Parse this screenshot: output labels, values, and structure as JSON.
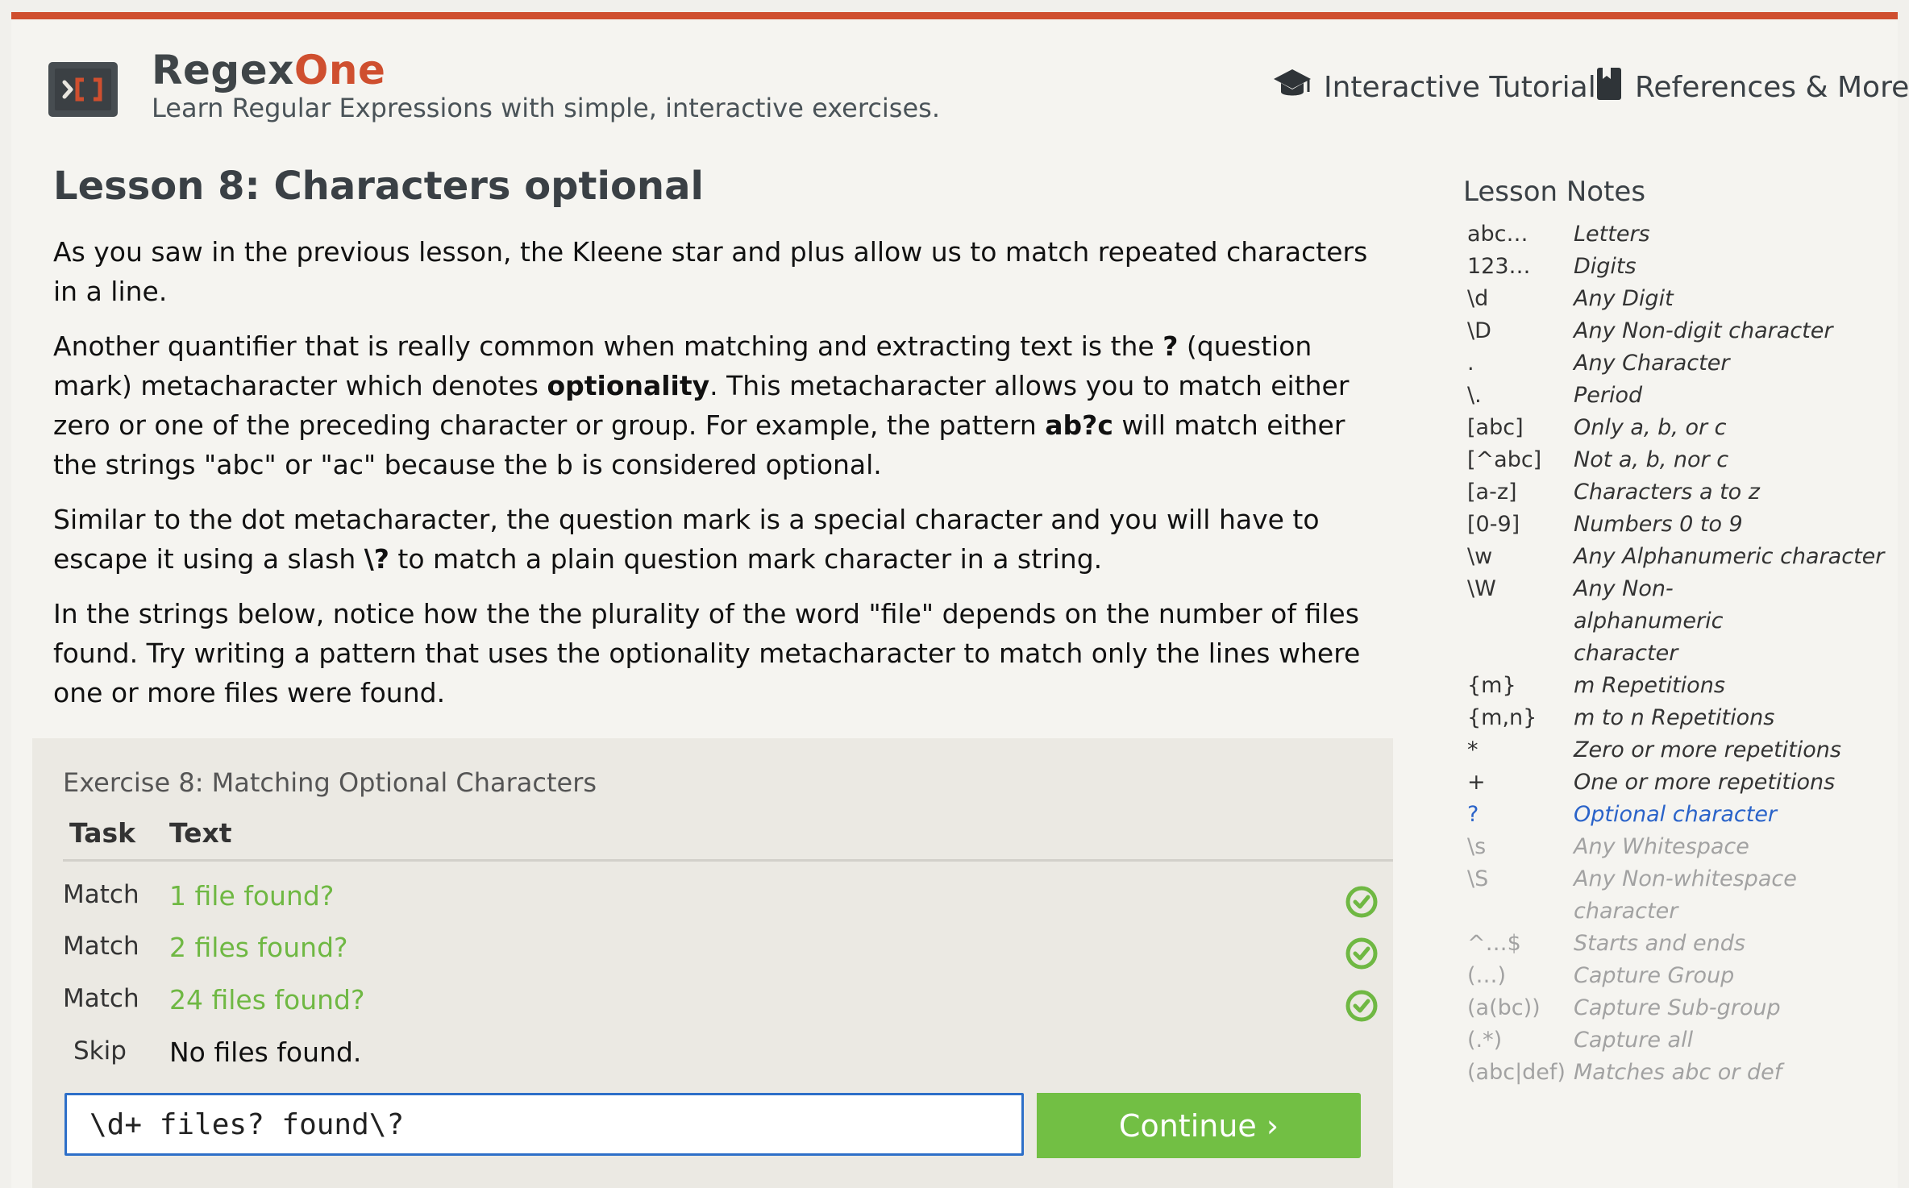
{
  "header": {
    "brand_main": "Regex",
    "brand_accent": "One",
    "tagline": "Learn Regular Expressions with simple, interactive exercises.",
    "logo_icon": "regex-bracket-logo-icon",
    "nav": {
      "tutorial": {
        "label": "Interactive Tutorial",
        "icon": "graduation-cap-icon"
      },
      "references": {
        "label": "References & More",
        "icon": "book-icon"
      }
    }
  },
  "colors": {
    "accent": "#cf4f2f",
    "success": "#6fb843",
    "continue": "#72bf44",
    "link": "#2a63c9",
    "input_border": "#2d6fc8"
  },
  "lesson": {
    "title": "Lesson 8: Characters optional",
    "p1": "As you saw in the previous lesson, the Kleene star and plus allow us to match repeated characters in a line.",
    "p2_a": "Another quantifier that is really common when matching and extracting text is the ",
    "p2_b": "?",
    "p2_c": " (question mark) metacharacter which denotes ",
    "p2_d": "optionality",
    "p2_e": ". This metacharacter allows you to match either zero or one of the preceding character or group. For example, the pattern ",
    "p2_f": "ab?c",
    "p2_g": " will match either the strings \"abc\" or \"ac\" because the b is considered optional.",
    "p3_a": "Similar to the dot metacharacter, the question mark is a special character and you will have to escape it using a slash ",
    "p3_b": "\\?",
    "p3_c": " to match a plain question mark character in a string.",
    "p4": "In the strings below, notice how the the plurality of the word \"file\" depends on the number of files found. Try writing a pattern that uses the optionality metacharacter to match only the lines where one or more files were found."
  },
  "exercise": {
    "title": "Exercise 8: Matching Optional Characters",
    "headers": {
      "task": "Task",
      "text": "Text"
    },
    "rows": [
      {
        "task": "Match",
        "text": "1 file found?",
        "status": "matched"
      },
      {
        "task": "Match",
        "text": "2 files found?",
        "status": "matched"
      },
      {
        "task": "Match",
        "text": "24 files found?",
        "status": "matched"
      },
      {
        "task": "Skip",
        "text": "No files found.",
        "status": "skipped"
      }
    ],
    "input_value": "\\d+ files? found\\?",
    "continue_label": "Continue ›"
  },
  "notes": {
    "title": "Lesson Notes",
    "items": [
      {
        "k": "abc…",
        "v": "Letters"
      },
      {
        "k": "123…",
        "v": "Digits"
      },
      {
        "k": "\\d",
        "v": "Any Digit"
      },
      {
        "k": "\\D",
        "v": "Any Non-digit character"
      },
      {
        "k": ".",
        "v": "Any Character"
      },
      {
        "k": "\\.",
        "v": "Period"
      },
      {
        "k": "[abc]",
        "v": "Only a, b, or c"
      },
      {
        "k": "[^abc]",
        "v": "Not a, b, nor c"
      },
      {
        "k": "[a-z]",
        "v": "Characters a to z"
      },
      {
        "k": "[0-9]",
        "v": "Numbers 0 to 9"
      },
      {
        "k": "\\w",
        "v": "Any Alphanumeric character"
      },
      {
        "k": "\\W",
        "v": "Any Non-alphanumeric character"
      },
      {
        "k": "{m}",
        "v": "m Repetitions"
      },
      {
        "k": "{m,n}",
        "v": "m to n Repetitions"
      },
      {
        "k": "*",
        "v": "Zero or more repetitions"
      },
      {
        "k": "+",
        "v": "One or more repetitions"
      },
      {
        "k": "?",
        "v": "Optional character"
      },
      {
        "k": "\\s",
        "v": "Any Whitespace"
      },
      {
        "k": "\\S",
        "v": "Any Non-whitespace character"
      },
      {
        "k": "^…$",
        "v": "Starts and ends"
      },
      {
        "k": "(…)",
        "v": "Capture Group"
      },
      {
        "k": "(a(bc))",
        "v": "Capture Sub-group"
      },
      {
        "k": "(.*)",
        "v": "Capture all"
      },
      {
        "k": "(abc|def)",
        "v": "Matches abc or def"
      }
    ]
  }
}
